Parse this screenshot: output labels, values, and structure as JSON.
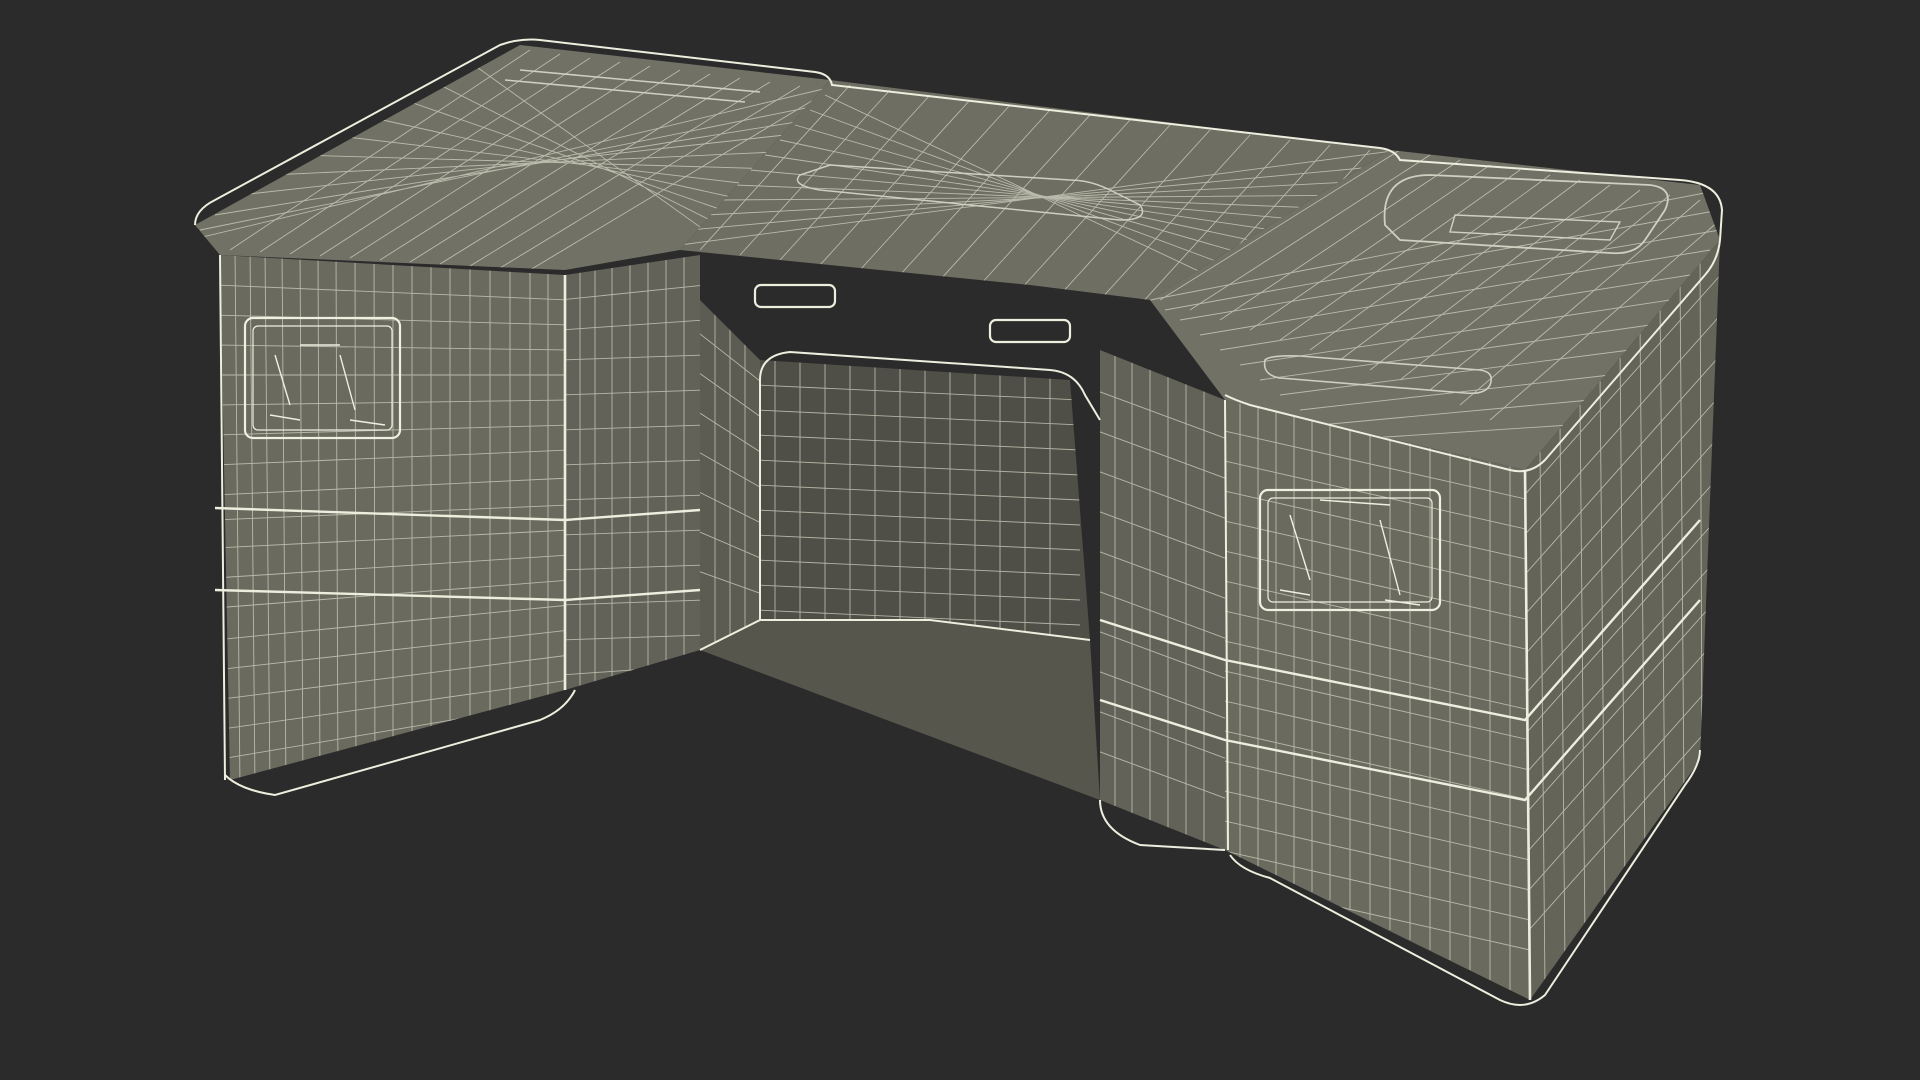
{
  "scene": {
    "subject": "wireframe-desk-model",
    "background_color": "#2b2b2b",
    "surface_color": "#6b6b60",
    "surface_dark_color": "#5a5a50",
    "wire_color": "#d8d8c8",
    "edge_color": "#f0f0e0"
  }
}
